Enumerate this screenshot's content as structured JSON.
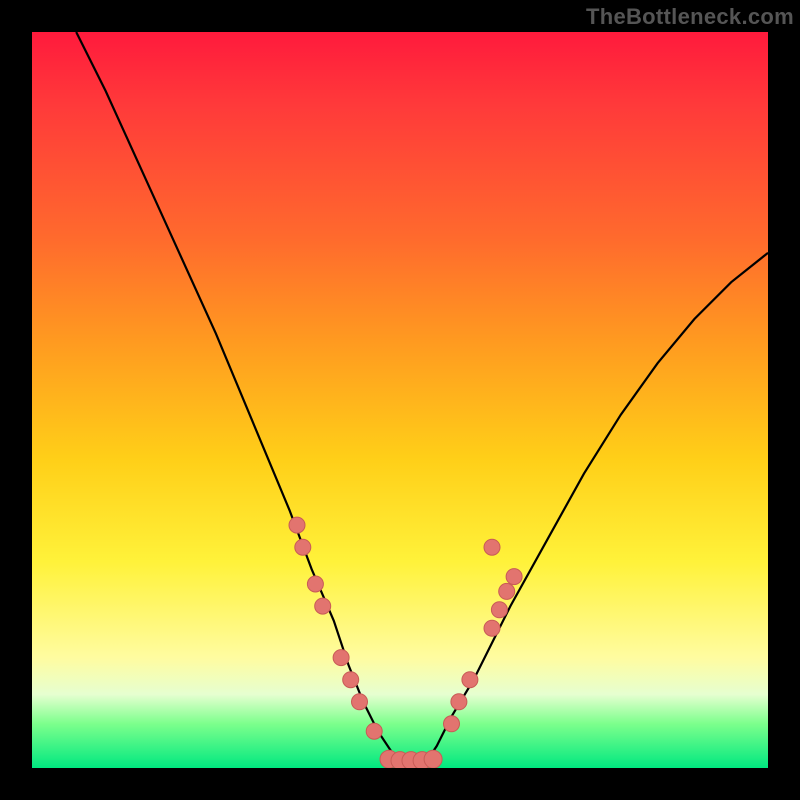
{
  "watermark": "TheBottleneck.com",
  "colors": {
    "frame": "#000000",
    "gradient_stops": [
      "#ff1a3c",
      "#ff3a3a",
      "#ff6a2d",
      "#ff9a20",
      "#ffcf18",
      "#fff23a",
      "#fffca0",
      "#e6ffd0",
      "#7cff8c",
      "#00e880"
    ],
    "curve": "#000000",
    "dot_fill": "#e2746f",
    "dot_stroke": "#c85b56"
  },
  "chart_data": {
    "type": "line",
    "title": "",
    "xlabel": "",
    "ylabel": "",
    "xlim": [
      0,
      100
    ],
    "ylim": [
      0,
      100
    ],
    "note": "No axis ticks or numeric labels are rendered; values are normalized 0-100 estimates read from pixel positions. y is plotted with 0 at bottom.",
    "series": [
      {
        "name": "curve",
        "x": [
          6,
          10,
          15,
          20,
          25,
          30,
          35,
          38,
          41,
          43,
          45,
          47,
          49,
          51,
          53,
          55,
          57,
          60,
          65,
          70,
          75,
          80,
          85,
          90,
          95,
          100
        ],
        "y": [
          100,
          92,
          81,
          70,
          59,
          47,
          35,
          27,
          20,
          14,
          9,
          5,
          2,
          0,
          0,
          3,
          7,
          12,
          22,
          31,
          40,
          48,
          55,
          61,
          66,
          70
        ]
      }
    ],
    "points": [
      {
        "name": "left-cluster",
        "x": 36.0,
        "y": 33.0
      },
      {
        "name": "left-cluster",
        "x": 36.8,
        "y": 30.0
      },
      {
        "name": "left-cluster",
        "x": 38.5,
        "y": 25.0
      },
      {
        "name": "left-cluster",
        "x": 39.5,
        "y": 22.0
      },
      {
        "name": "left-cluster",
        "x": 42.0,
        "y": 15.0
      },
      {
        "name": "left-cluster",
        "x": 43.3,
        "y": 12.0
      },
      {
        "name": "left-cluster",
        "x": 44.5,
        "y": 9.0
      },
      {
        "name": "left-cluster",
        "x": 46.5,
        "y": 5.0
      },
      {
        "name": "bottom-pill",
        "x": 48.5,
        "y": 1.2
      },
      {
        "name": "bottom-pill",
        "x": 50.0,
        "y": 1.0
      },
      {
        "name": "bottom-pill",
        "x": 51.5,
        "y": 1.0
      },
      {
        "name": "bottom-pill",
        "x": 53.0,
        "y": 1.0
      },
      {
        "name": "bottom-pill",
        "x": 54.5,
        "y": 1.2
      },
      {
        "name": "right-cluster",
        "x": 57.0,
        "y": 6.0
      },
      {
        "name": "right-cluster",
        "x": 58.0,
        "y": 9.0
      },
      {
        "name": "right-cluster",
        "x": 59.5,
        "y": 12.0
      },
      {
        "name": "right-cluster",
        "x": 62.5,
        "y": 19.0
      },
      {
        "name": "right-cluster",
        "x": 63.5,
        "y": 21.5
      },
      {
        "name": "right-cluster",
        "x": 64.5,
        "y": 24.0
      },
      {
        "name": "right-cluster",
        "x": 65.5,
        "y": 26.0
      },
      {
        "name": "right-cluster",
        "x": 62.5,
        "y": 30.0
      }
    ]
  }
}
